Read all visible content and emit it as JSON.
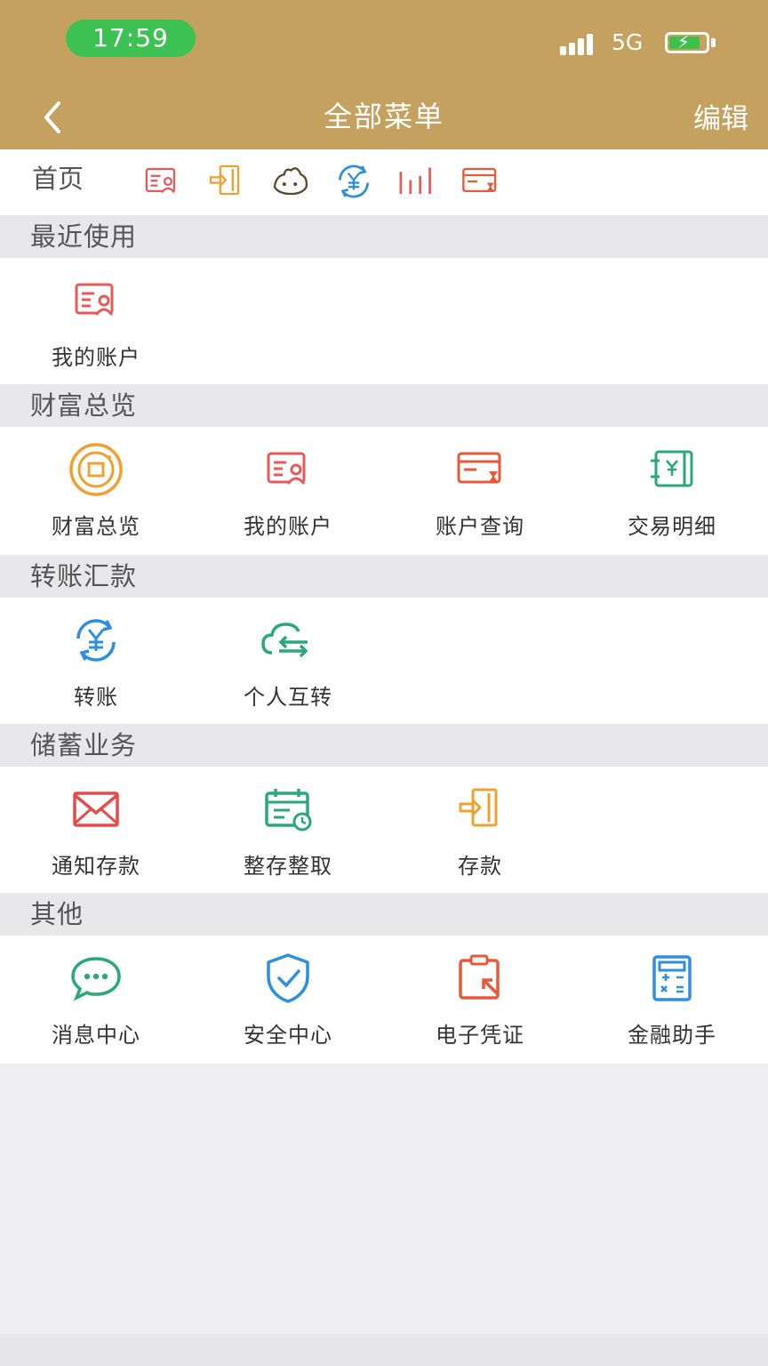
{
  "status": {
    "time": "17:59",
    "network": "5G",
    "battery_level": 0.85,
    "accent": "#3cc152"
  },
  "header": {
    "title": "全部菜单",
    "edit_label": "编辑",
    "background": "#c5a15f"
  },
  "home": {
    "label": "首页",
    "icons": [
      "account-icon",
      "deposit-icon",
      "wealth-face-icon",
      "transfer-icon",
      "chart-bars-icon",
      "account-query-icon"
    ]
  },
  "sections": [
    {
      "title": "最近使用",
      "items": [
        {
          "label": "我的账户",
          "icon": "account-icon"
        }
      ]
    },
    {
      "title": "财富总览",
      "items": [
        {
          "label": "财富总览",
          "icon": "wealth-overview-icon"
        },
        {
          "label": "我的账户",
          "icon": "account-icon"
        },
        {
          "label": "账户查询",
          "icon": "account-query-icon"
        },
        {
          "label": "交易明细",
          "icon": "transaction-detail-icon"
        }
      ]
    },
    {
      "title": "转账汇款",
      "items": [
        {
          "label": "转账",
          "icon": "transfer-icon"
        },
        {
          "label": "个人互转",
          "icon": "personal-transfer-icon"
        }
      ]
    },
    {
      "title": "储蓄业务",
      "items": [
        {
          "label": "通知存款",
          "icon": "notice-deposit-icon"
        },
        {
          "label": "整存整取",
          "icon": "fixed-deposit-icon"
        },
        {
          "label": "存款",
          "icon": "deposit-icon"
        }
      ]
    },
    {
      "title": "其他",
      "items": [
        {
          "label": "消息中心",
          "icon": "message-icon"
        },
        {
          "label": "安全中心",
          "icon": "security-icon"
        },
        {
          "label": "电子凭证",
          "icon": "e-voucher-icon"
        },
        {
          "label": "金融助手",
          "icon": "calculator-icon"
        }
      ]
    }
  ]
}
